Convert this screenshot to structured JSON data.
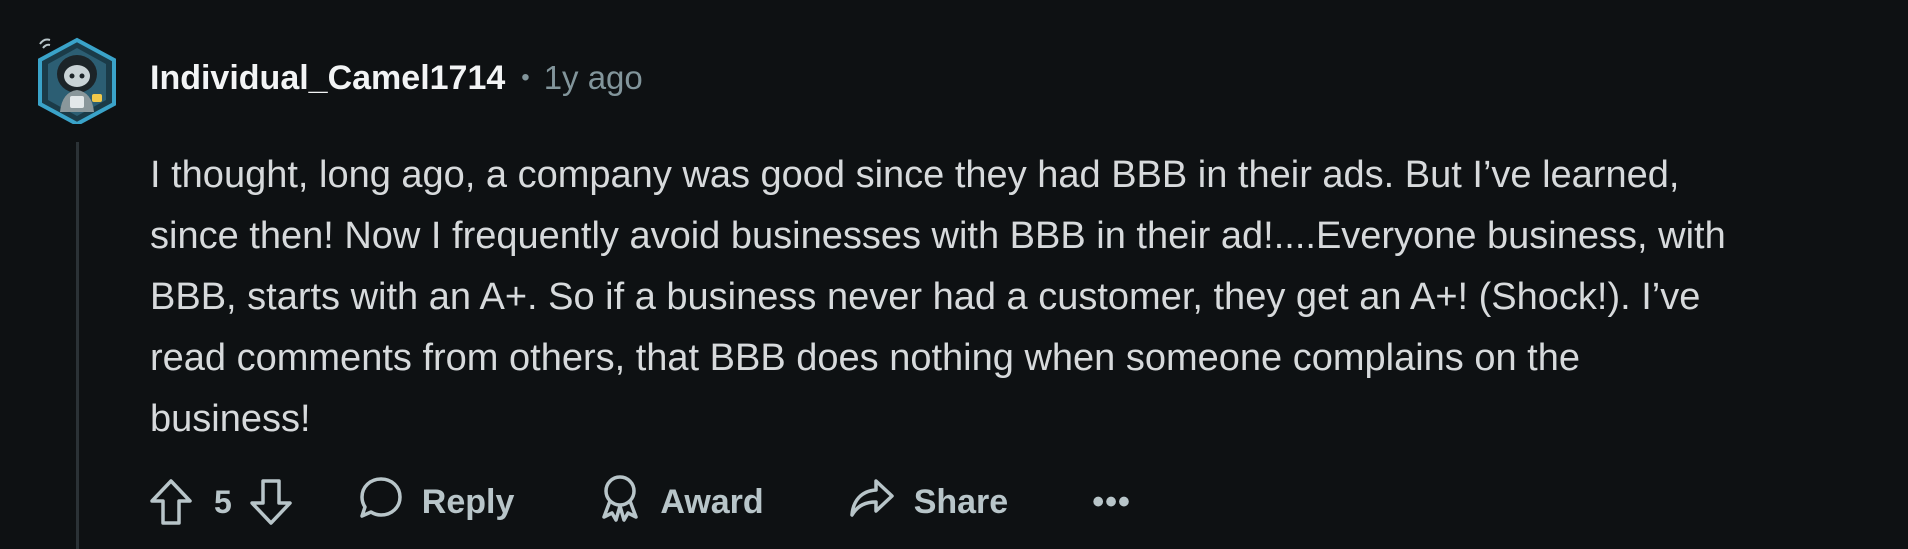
{
  "comment": {
    "author": "Individual_Camel1714",
    "separator": "•",
    "timestamp": "1y ago",
    "body_lines": [
      "I thought, long ago, a company was good since they had BBB in their ads. But I’ve learned,",
      "since then! Now I frequently avoid businesses with BBB in their ad!....Everyone business, with",
      "BBB, starts with an A+. So if a business never had a customer, they get an A+! (Shock!). I’ve",
      "read comments from others, that BBB does nothing when someone complains on the",
      "business!"
    ]
  },
  "actions": {
    "score": "5",
    "reply_label": "Reply",
    "award_label": "Award",
    "share_label": "Share",
    "more_label": "•••"
  },
  "icons": {
    "upvote": "arrow-up-icon",
    "downvote": "arrow-down-icon",
    "reply": "speech-bubble-icon",
    "award": "award-ribbon-icon",
    "share": "share-arrow-icon",
    "more": "ellipsis-icon",
    "avatar": "user-avatar"
  },
  "colors": {
    "background": "#0e1113",
    "text": "#d7dadc",
    "muted": "#82959b",
    "action": "#b8c5c9",
    "thread_line": "#2b3236",
    "avatar_accent": "#3aa3c9"
  }
}
